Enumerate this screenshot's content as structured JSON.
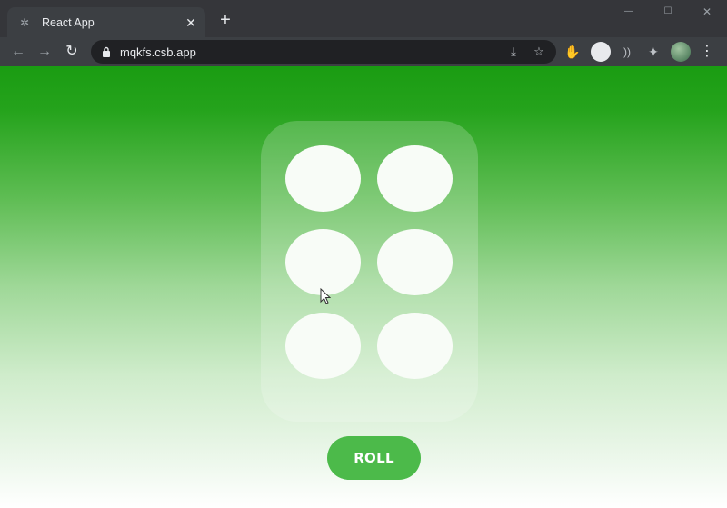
{
  "browser": {
    "tab_title": "React App",
    "tab_close": "✕",
    "new_tab": "+",
    "url": "mqkfs.csb.app",
    "window_controls": {
      "minimize": "—",
      "maximize": "☐",
      "close": "✕"
    },
    "icons": {
      "back": "←",
      "forward": "→",
      "reload": "↻",
      "install": "⤓",
      "star": "☆",
      "hand": "✋",
      "cast": "))",
      "puzzle": "✦",
      "menu": "⋮",
      "favicon": "✲"
    }
  },
  "app": {
    "dice": {
      "pip_count": 6,
      "pip_color": "#f8fcf7",
      "panel_color": "rgba(255,255,255,0.2)"
    },
    "roll_label": "ROLL",
    "colors": {
      "gradient_top": "#1a9c12",
      "gradient_bottom": "#ffffff",
      "button": "#4cba4a"
    }
  }
}
